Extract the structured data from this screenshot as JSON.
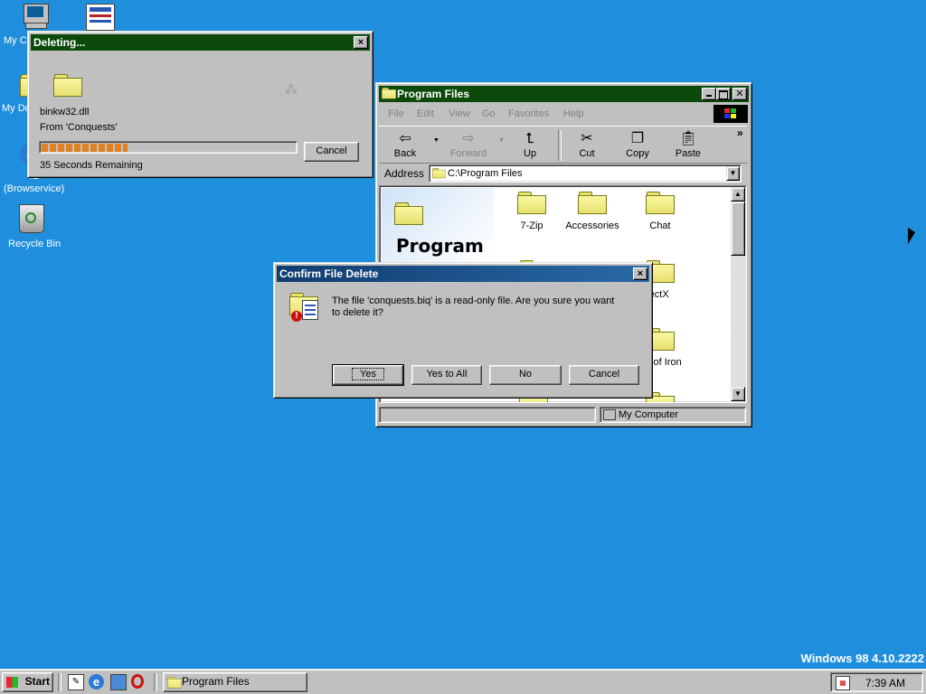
{
  "desktop": {
    "icons": [
      {
        "name": "my-computer",
        "label": "My C"
      },
      {
        "name": "my-documents",
        "label": "My Do"
      },
      {
        "name": "ie-browser",
        "label": "IE\n(Browservice)"
      },
      {
        "name": "recycle-bin",
        "label": "Recycle Bin"
      }
    ],
    "version_text": "Windows 98 4.10.2222"
  },
  "deleting_dialog": {
    "title": "Deleting...",
    "close": "×",
    "file_name": "binkw32.dll",
    "from": "From 'Conquests'",
    "progress": 0.34,
    "remaining": "35 Seconds Remaining",
    "cancel": "Cancel"
  },
  "explorer": {
    "title": "Program Files",
    "menu": [
      "File",
      "Edit",
      "View",
      "Go",
      "Favorites",
      "Help"
    ],
    "toolbar": [
      {
        "label": "Back",
        "icon": "back-arrow-icon",
        "enabled": true
      },
      {
        "label": "Forward",
        "icon": "forward-arrow-icon",
        "enabled": false
      },
      {
        "label": "Up",
        "icon": "up-folder-icon",
        "enabled": true
      },
      {
        "label": "Cut",
        "icon": "scissors-icon",
        "enabled": true
      },
      {
        "label": "Copy",
        "icon": "copy-icon",
        "enabled": true
      },
      {
        "label": "Paste",
        "icon": "paste-icon",
        "enabled": true
      }
    ],
    "more": "»",
    "address_label": "Address",
    "address_value": "C:\\Program Files",
    "banner_title": "Program",
    "folders": [
      "7-Zip",
      "Accessories",
      "Chat",
      "rectX",
      "s of Iron"
    ],
    "status": "My Computer"
  },
  "confirm_dialog": {
    "title": "Confirm File Delete",
    "close": "×",
    "message": "The file 'conquests.biq' is a read-only file. Are you sure you want to delete it?",
    "buttons": {
      "yes": "Yes",
      "yes_all": "Yes to All",
      "no": "No",
      "cancel": "Cancel"
    }
  },
  "taskbar": {
    "start": "Start",
    "task": "Program Files",
    "clock": "7:39 AM"
  },
  "colors": {
    "desktop": "#1f8fdd",
    "title_green": "#0b4a0b",
    "title_blue": "#0f3c6e",
    "progress": "#e08020"
  }
}
